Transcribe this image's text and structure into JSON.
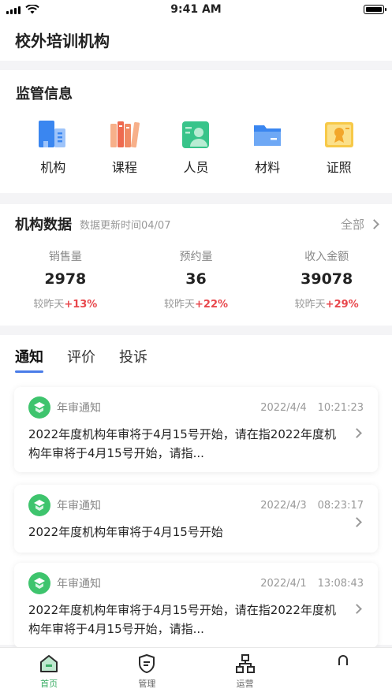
{
  "status": {
    "time": "9:41 AM"
  },
  "app": {
    "title": "校外培训机构"
  },
  "supervision": {
    "title": "监管信息",
    "items": [
      {
        "label": "机构",
        "icon": "building-icon"
      },
      {
        "label": "课程",
        "icon": "books-icon"
      },
      {
        "label": "人员",
        "icon": "person-card-icon"
      },
      {
        "label": "材料",
        "icon": "folder-icon"
      },
      {
        "label": "证照",
        "icon": "certificate-icon"
      }
    ]
  },
  "org_data": {
    "title": "机构数据",
    "update": "数据更新时间04/07",
    "all_label": "全部",
    "metrics": [
      {
        "label": "销售量",
        "value": "2978",
        "cmp": "较昨天",
        "delta": "+13%"
      },
      {
        "label": "预约量",
        "value": "36",
        "cmp": "较昨天",
        "delta": "+22%"
      },
      {
        "label": "收入金额",
        "value": "39078",
        "cmp": "较昨天",
        "delta": "+29%"
      }
    ]
  },
  "tabs": [
    "通知",
    "评价",
    "投诉"
  ],
  "notices": [
    {
      "type": "年审通知",
      "date": "2022/4/4",
      "time": "10:21:23",
      "text": "2022年度机构年审将于4月15号开始，请在指2022年度机构年审将于4月15号开始，请指..."
    },
    {
      "type": "年审通知",
      "date": "2022/4/3",
      "time": "08:23:17",
      "text": "2022年度机构年审将于4月15号开始"
    },
    {
      "type": "年审通知",
      "date": "2022/4/1",
      "time": "13:08:43",
      "text": "2022年度机构年审将于4月15号开始，请在指2022年度机构年审将于4月15号开始，请指..."
    }
  ],
  "tabbar": [
    {
      "label": "首页",
      "icon": "home-icon"
    },
    {
      "label": "管理",
      "icon": "shield-icon"
    },
    {
      "label": "运营",
      "icon": "org-chart-icon"
    },
    {
      "label": "",
      "icon": "profile-icon"
    }
  ],
  "colors": {
    "accent_green": "#3cae66",
    "delta_red": "#e8474c",
    "tab_underline": "#4a7ce8"
  }
}
